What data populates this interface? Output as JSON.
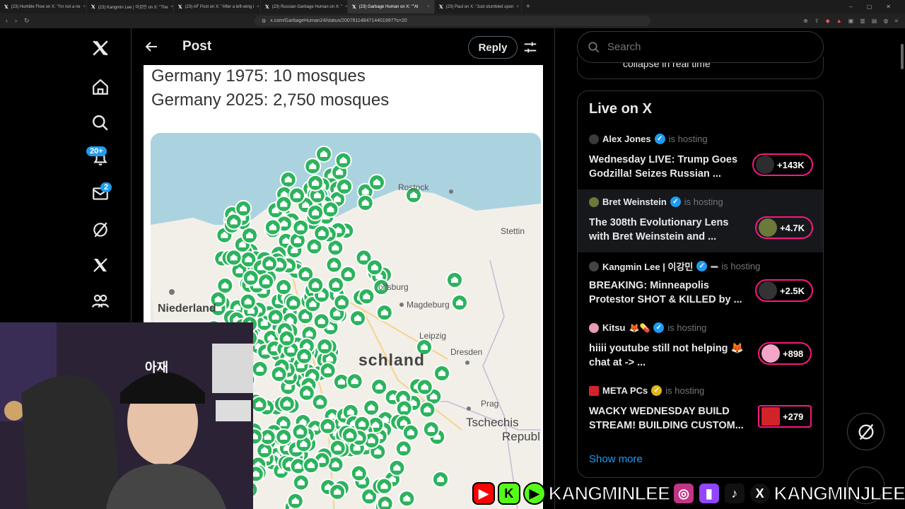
{
  "browser": {
    "tabs": [
      {
        "title": "(23) Humble Flow on X: \"I'm not a ne"
      },
      {
        "title": "(23) Kangmin Lee | 이강민 on X: \"The"
      },
      {
        "title": "(23) AF Post on X: \"After a left-wing i"
      },
      {
        "title": "(23) Russian Garbage Human on X: \""
      },
      {
        "title": "(23) Garbage Human on X: \"\"Al"
      },
      {
        "title": "(23) Paul on X: \"Just stumbled upon"
      }
    ],
    "url": "x.com/GarbageHuman24/status/2007811484714401997?s=20"
  },
  "nav": {
    "notifications_badge": "20+",
    "messages_badge": "2"
  },
  "header": {
    "title": "Post",
    "reply_label": "Reply"
  },
  "post": {
    "line1": "Germany 1975: 10 mosques",
    "line2": "Germany 2025: 2,750 mosques",
    "map_labels": {
      "rostock": "Rostock",
      "stettin": "Stettin",
      "niederlande": "Niederland",
      "wolfsburg": "olfsburg",
      "magdeburg": "Magdeburg",
      "deutschland": "schland",
      "leipzig": "Leipzig",
      "dresden": "Dresden",
      "prag": "Prag",
      "tschechien": "Tschechis",
      "republik": "Republi"
    }
  },
  "sidebar": {
    "search_placeholder": "Search",
    "prev_card_text": "collapse in real time",
    "live_title": "Live on X",
    "hosting_label": "is hosting",
    "items": [
      {
        "host": "Alex Jones",
        "title": "Wednesday LIVE: Trump Goes Godzilla! Seizes Russian ...",
        "count": "+143K"
      },
      {
        "host": "Bret Weinstein",
        "title": "The 308th Evolutionary Lens with Bret Weinstein and ...",
        "count": "+4.7K"
      },
      {
        "host": "Kangmin Lee | 이강민",
        "title": "BREAKING: Minneapolis Protestor SHOT & KILLED by ...",
        "count": "+2.5K"
      },
      {
        "host": "Kitsu",
        "title": "hiiii youtube still not helping 🦊 chat at -> ...",
        "count": "+898"
      },
      {
        "host": "META PCs",
        "title": "WACKY WEDNESDAY BUILD STREAM! BUILDING CUSTOM...",
        "count": "+279"
      }
    ],
    "show_more": "Show more"
  },
  "overlay": {
    "handle1": "KANGMINLEE",
    "handle2": "KANGMINJLEE",
    "cap_text": "아재"
  },
  "colors": {
    "accent": "#1d9bf0",
    "live_pink": "#f91880",
    "marker_green": "#2db35d"
  }
}
